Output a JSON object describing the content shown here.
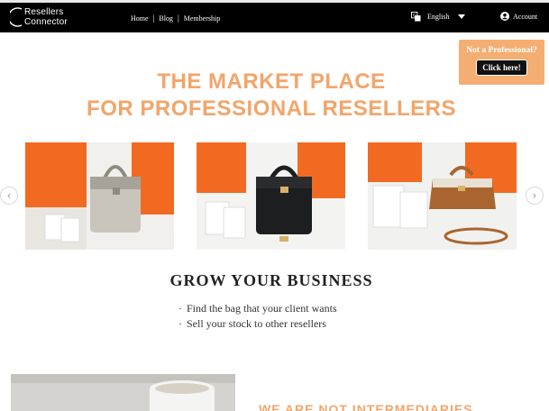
{
  "brand": {
    "line1": "Resellers",
    "line2": "Connector"
  },
  "nav": {
    "home": "Home",
    "blog": "Blog",
    "membership": "Membership",
    "separator": "|"
  },
  "language": {
    "selected": "English"
  },
  "account": {
    "label": "Account"
  },
  "promo": {
    "question": "Not a Professional?",
    "button": "Click here!"
  },
  "hero": {
    "line1": "THE MARKET PLACE",
    "line2": "FOR PROFESSIONAL RESELLERS"
  },
  "carousel": {
    "prev_symbol": "‹",
    "next_symbol": "›",
    "slides": [
      {
        "bag_color": "#c9c5bd",
        "accent": "#8f8a80"
      },
      {
        "bag_color": "#1c1e20",
        "accent": "#d7b16a"
      },
      {
        "bag_color": "#a9652f",
        "accent": "#e8e0d2"
      }
    ]
  },
  "grow": {
    "title": "GROW YOUR BUSINESS",
    "bullets": [
      "Find the bag that your client wants",
      "Sell your stock to other resellers"
    ]
  },
  "section2": {
    "title": "WE ARE NOT INTERMEDIARIES"
  },
  "colors": {
    "accent": "#f2a56a",
    "promo_bg": "#f4ae72",
    "nav_bg": "#000000",
    "box_orange": "#f26a21"
  },
  "icons": {
    "language": "translate-icon",
    "language_caret": "chevron-down-icon",
    "account": "user-circle-icon"
  }
}
